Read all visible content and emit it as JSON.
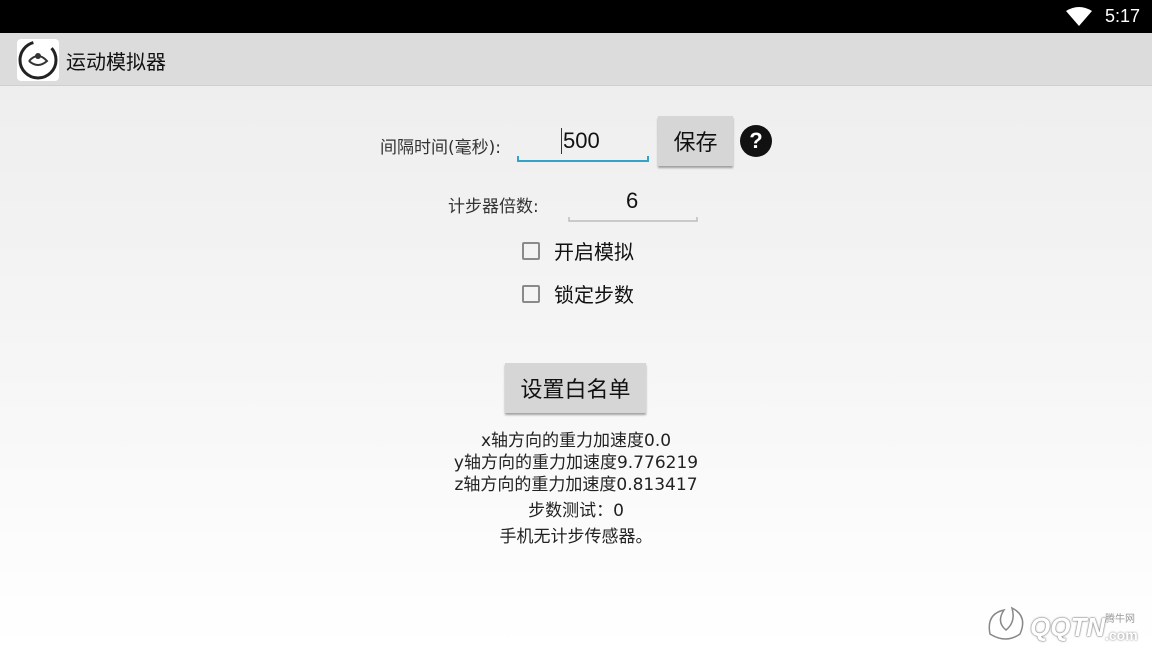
{
  "status_bar": {
    "time": "5:17",
    "wifi_icon": "wifi-icon"
  },
  "app_bar": {
    "title": "运动模拟器",
    "icon": "app-logo-icon"
  },
  "form": {
    "interval_label": "间隔时间(毫秒):",
    "interval_value": "500",
    "save_label": "保存",
    "help_icon_text": "?",
    "multiplier_label": "计步器倍数:",
    "multiplier_value": "6",
    "enable_sim_label": "开启模拟",
    "lock_steps_label": "锁定步数",
    "enable_sim_checked": false,
    "lock_steps_checked": false,
    "whitelist_label": "设置白名单"
  },
  "info": {
    "x_gravity": "x轴方向的重力加速度0.0",
    "y_gravity": "y轴方向的重力加速度9.776219",
    "z_gravity": "z轴方向的重力加速度0.813417",
    "step_test": "步数测试：0",
    "sensor_status": "手机无计步传感器。"
  },
  "watermark": {
    "text": "QQTN",
    "small": "腾牛网",
    "suffix": ".com"
  },
  "colors": {
    "accent": "#33a3c7",
    "status_bar": "#000000",
    "action_bar": "#dcdcdc"
  }
}
